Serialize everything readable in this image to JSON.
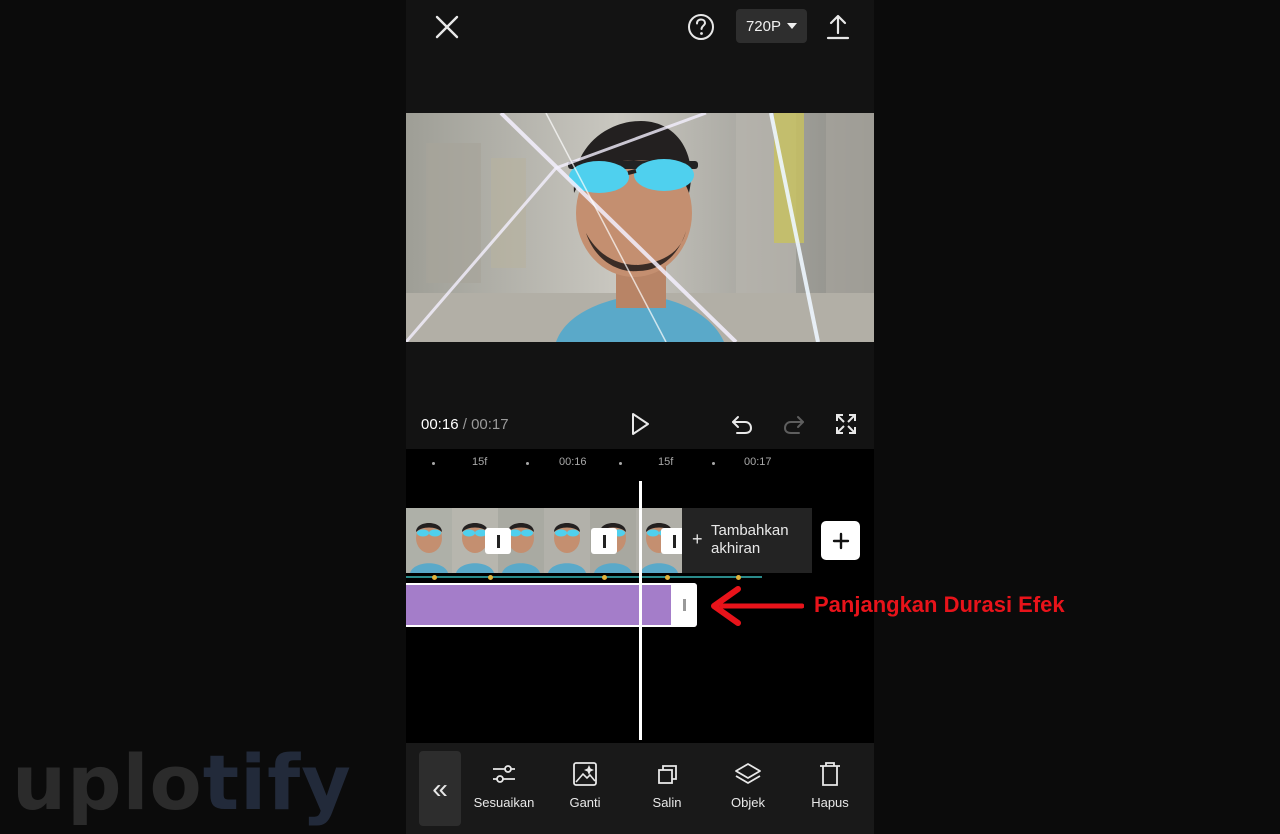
{
  "header": {
    "resolution": "720P"
  },
  "player": {
    "current_time": "00:16",
    "separator": " / ",
    "total_time": "00:17"
  },
  "ruler": {
    "labels": [
      "15f",
      "00:16",
      "15f",
      "00:17"
    ]
  },
  "timeline": {
    "add_end_label": "Tambahkan akhiran",
    "add_end_plus": "+"
  },
  "toolbar": {
    "back_label": "«",
    "items": [
      {
        "label": "Sesuaikan",
        "icon": "sliders-icon"
      },
      {
        "label": "Ganti",
        "icon": "replace-image-icon"
      },
      {
        "label": "Salin",
        "icon": "copy-icon"
      },
      {
        "label": "Objek",
        "icon": "layers-icon"
      },
      {
        "label": "Hapus",
        "icon": "trash-icon"
      }
    ]
  },
  "annotation": {
    "text": "Panjangkan Durasi Efek",
    "color": "#e8131a"
  },
  "watermark": {
    "part1": "uplo",
    "part2": "tify"
  },
  "colors": {
    "effect_clip": "#a47dc9",
    "keyframe": "#e0b23a"
  }
}
